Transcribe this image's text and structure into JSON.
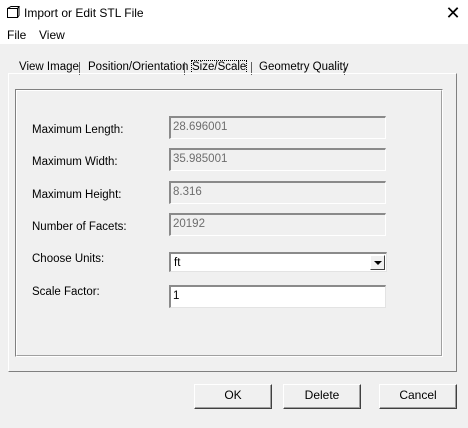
{
  "window": {
    "title": "Import or Edit STL File",
    "close_glyph": "✕",
    "icon": "stl-file-icon"
  },
  "menu": {
    "items": [
      {
        "label": "File"
      },
      {
        "label": "View"
      }
    ]
  },
  "tabs": [
    {
      "label": "View Image",
      "active": false
    },
    {
      "label": "Position/Orientation",
      "active": false
    },
    {
      "label": "Size/Scale",
      "active": true
    },
    {
      "label": "Geometry Quality",
      "active": false
    }
  ],
  "fields": {
    "max_length": {
      "label": "Maximum Length:",
      "value": "28.696001",
      "readonly": true
    },
    "max_width": {
      "label": "Maximum Width:",
      "value": "35.985001",
      "readonly": true
    },
    "max_height": {
      "label": "Maximum Height:",
      "value": "8.316",
      "readonly": true
    },
    "num_facets": {
      "label": "Number of Facets:",
      "value": "20192",
      "readonly": true
    },
    "units": {
      "label": "Choose Units:",
      "value": "ft"
    },
    "scale_factor": {
      "label": "Scale Factor:",
      "value": "1"
    }
  },
  "buttons": {
    "ok": "OK",
    "delete": "Delete",
    "cancel": "Cancel"
  }
}
